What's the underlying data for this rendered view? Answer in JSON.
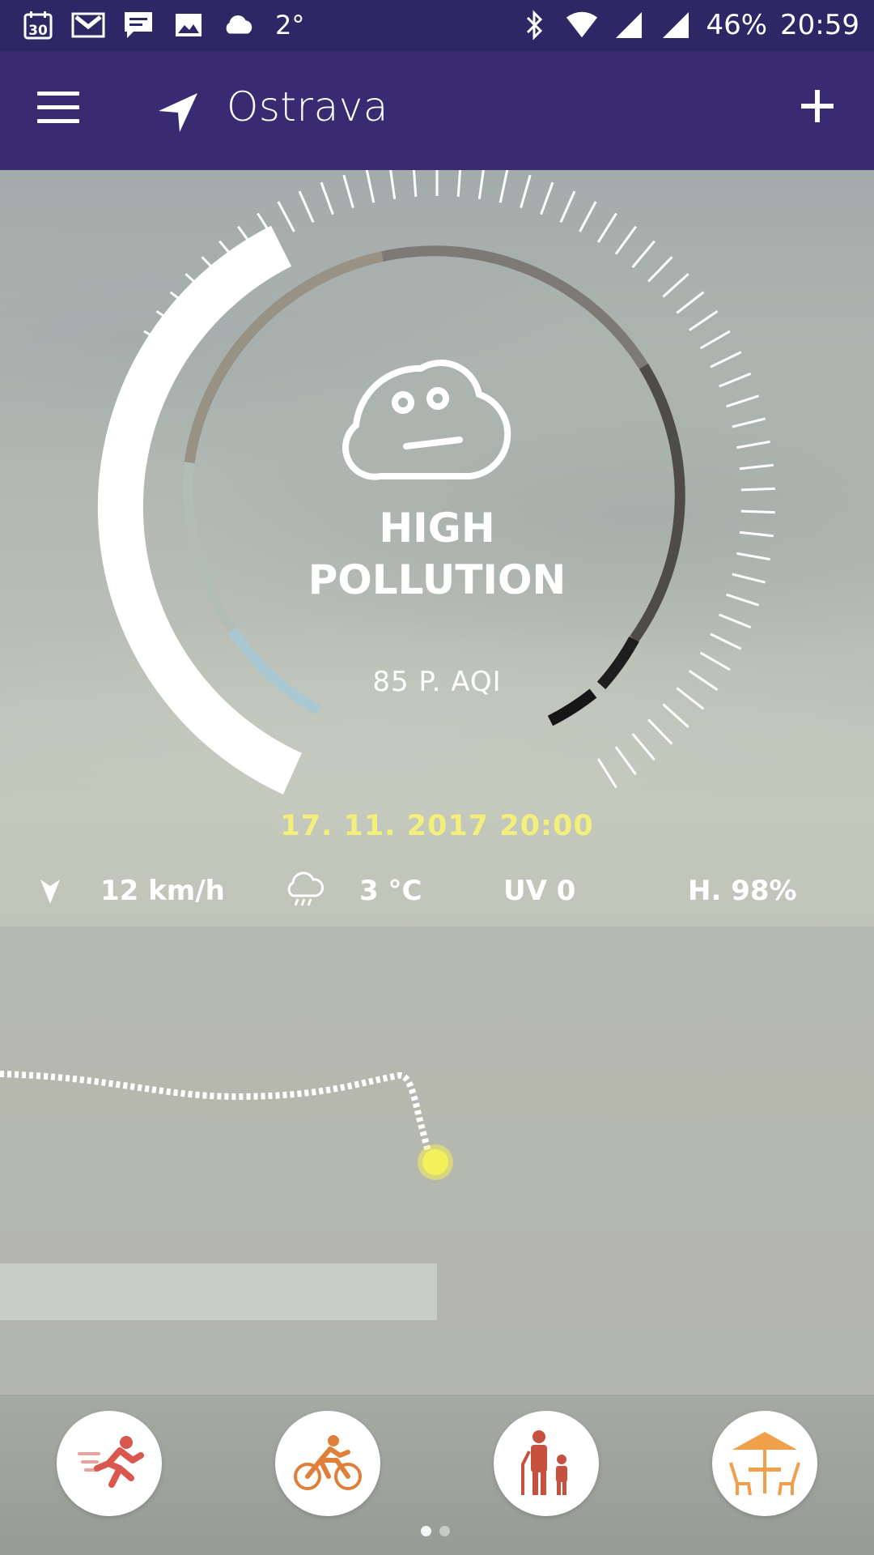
{
  "status_bar": {
    "temperature": "2°",
    "battery": "46%",
    "time": "20:59",
    "icons": [
      "calendar-icon",
      "gmail-icon",
      "message-icon",
      "image-icon",
      "cloud-icon",
      "bluetooth-icon",
      "wifi-icon",
      "signal-icon",
      "signal-icon"
    ]
  },
  "app_bar": {
    "city": "Ostrava",
    "menu_icon": "menu-icon",
    "location_icon": "navigation-arrow-icon",
    "add_icon": "plus-icon"
  },
  "gauge": {
    "face_icon": "neutral-cloud-face-icon",
    "status_line1": "HIGH",
    "status_line2": "POLLUTION",
    "aqi_label": "85 P. AQI",
    "datetime": "17. 11. 2017 20:00"
  },
  "weather": {
    "wind_icon": "wind-direction-icon",
    "wind": "12 km/h",
    "condition_icon": "rain-cloud-icon",
    "temperature": "3 °C",
    "uv": "UV 0",
    "humidity": "H. 98%"
  },
  "activities": [
    {
      "name": "running",
      "icon": "runner-icon"
    },
    {
      "name": "cycling",
      "icon": "cyclist-icon"
    },
    {
      "name": "elderly-and-children",
      "icon": "elder-child-icon"
    },
    {
      "name": "outdoor-seating",
      "icon": "patio-umbrella-icon"
    }
  ],
  "pager": {
    "pages": 2,
    "current": 1
  },
  "colors": {
    "status_bar": "#2e2766",
    "app_bar": "#392b72",
    "date_text": "#f2f07a",
    "marker": "#f4f05a"
  }
}
